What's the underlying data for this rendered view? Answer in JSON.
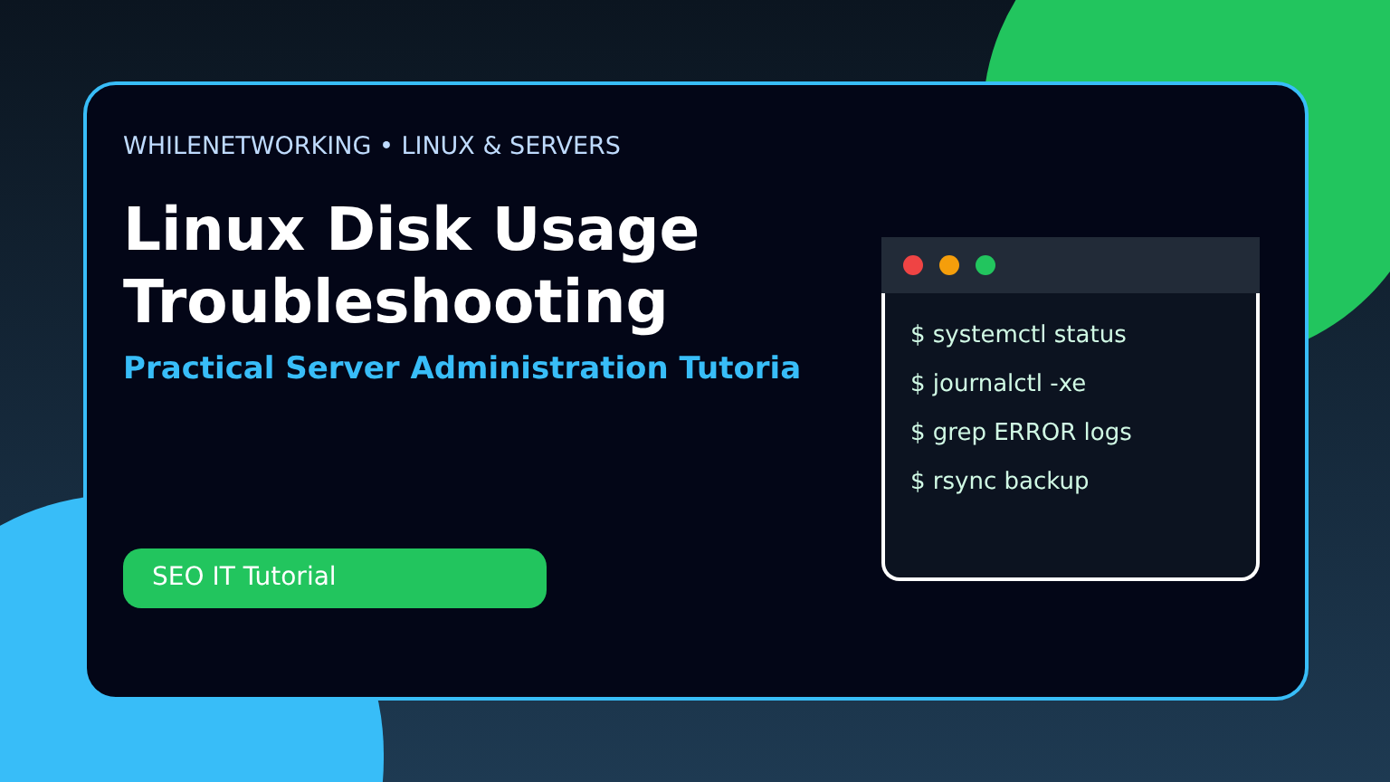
{
  "kicker": "WHILENETWORKING • LINUX & SERVERS",
  "title_lines": [
    "Linux Disk Usage",
    "Troubleshooting"
  ],
  "subtitle": "Practical Server Administration Tutoria",
  "badge": "SEO IT Tutorial",
  "terminal": {
    "lines": [
      "$ systemctl status",
      "$ journalctl -xe",
      "$ grep ERROR logs",
      "$ rsync backup"
    ]
  }
}
